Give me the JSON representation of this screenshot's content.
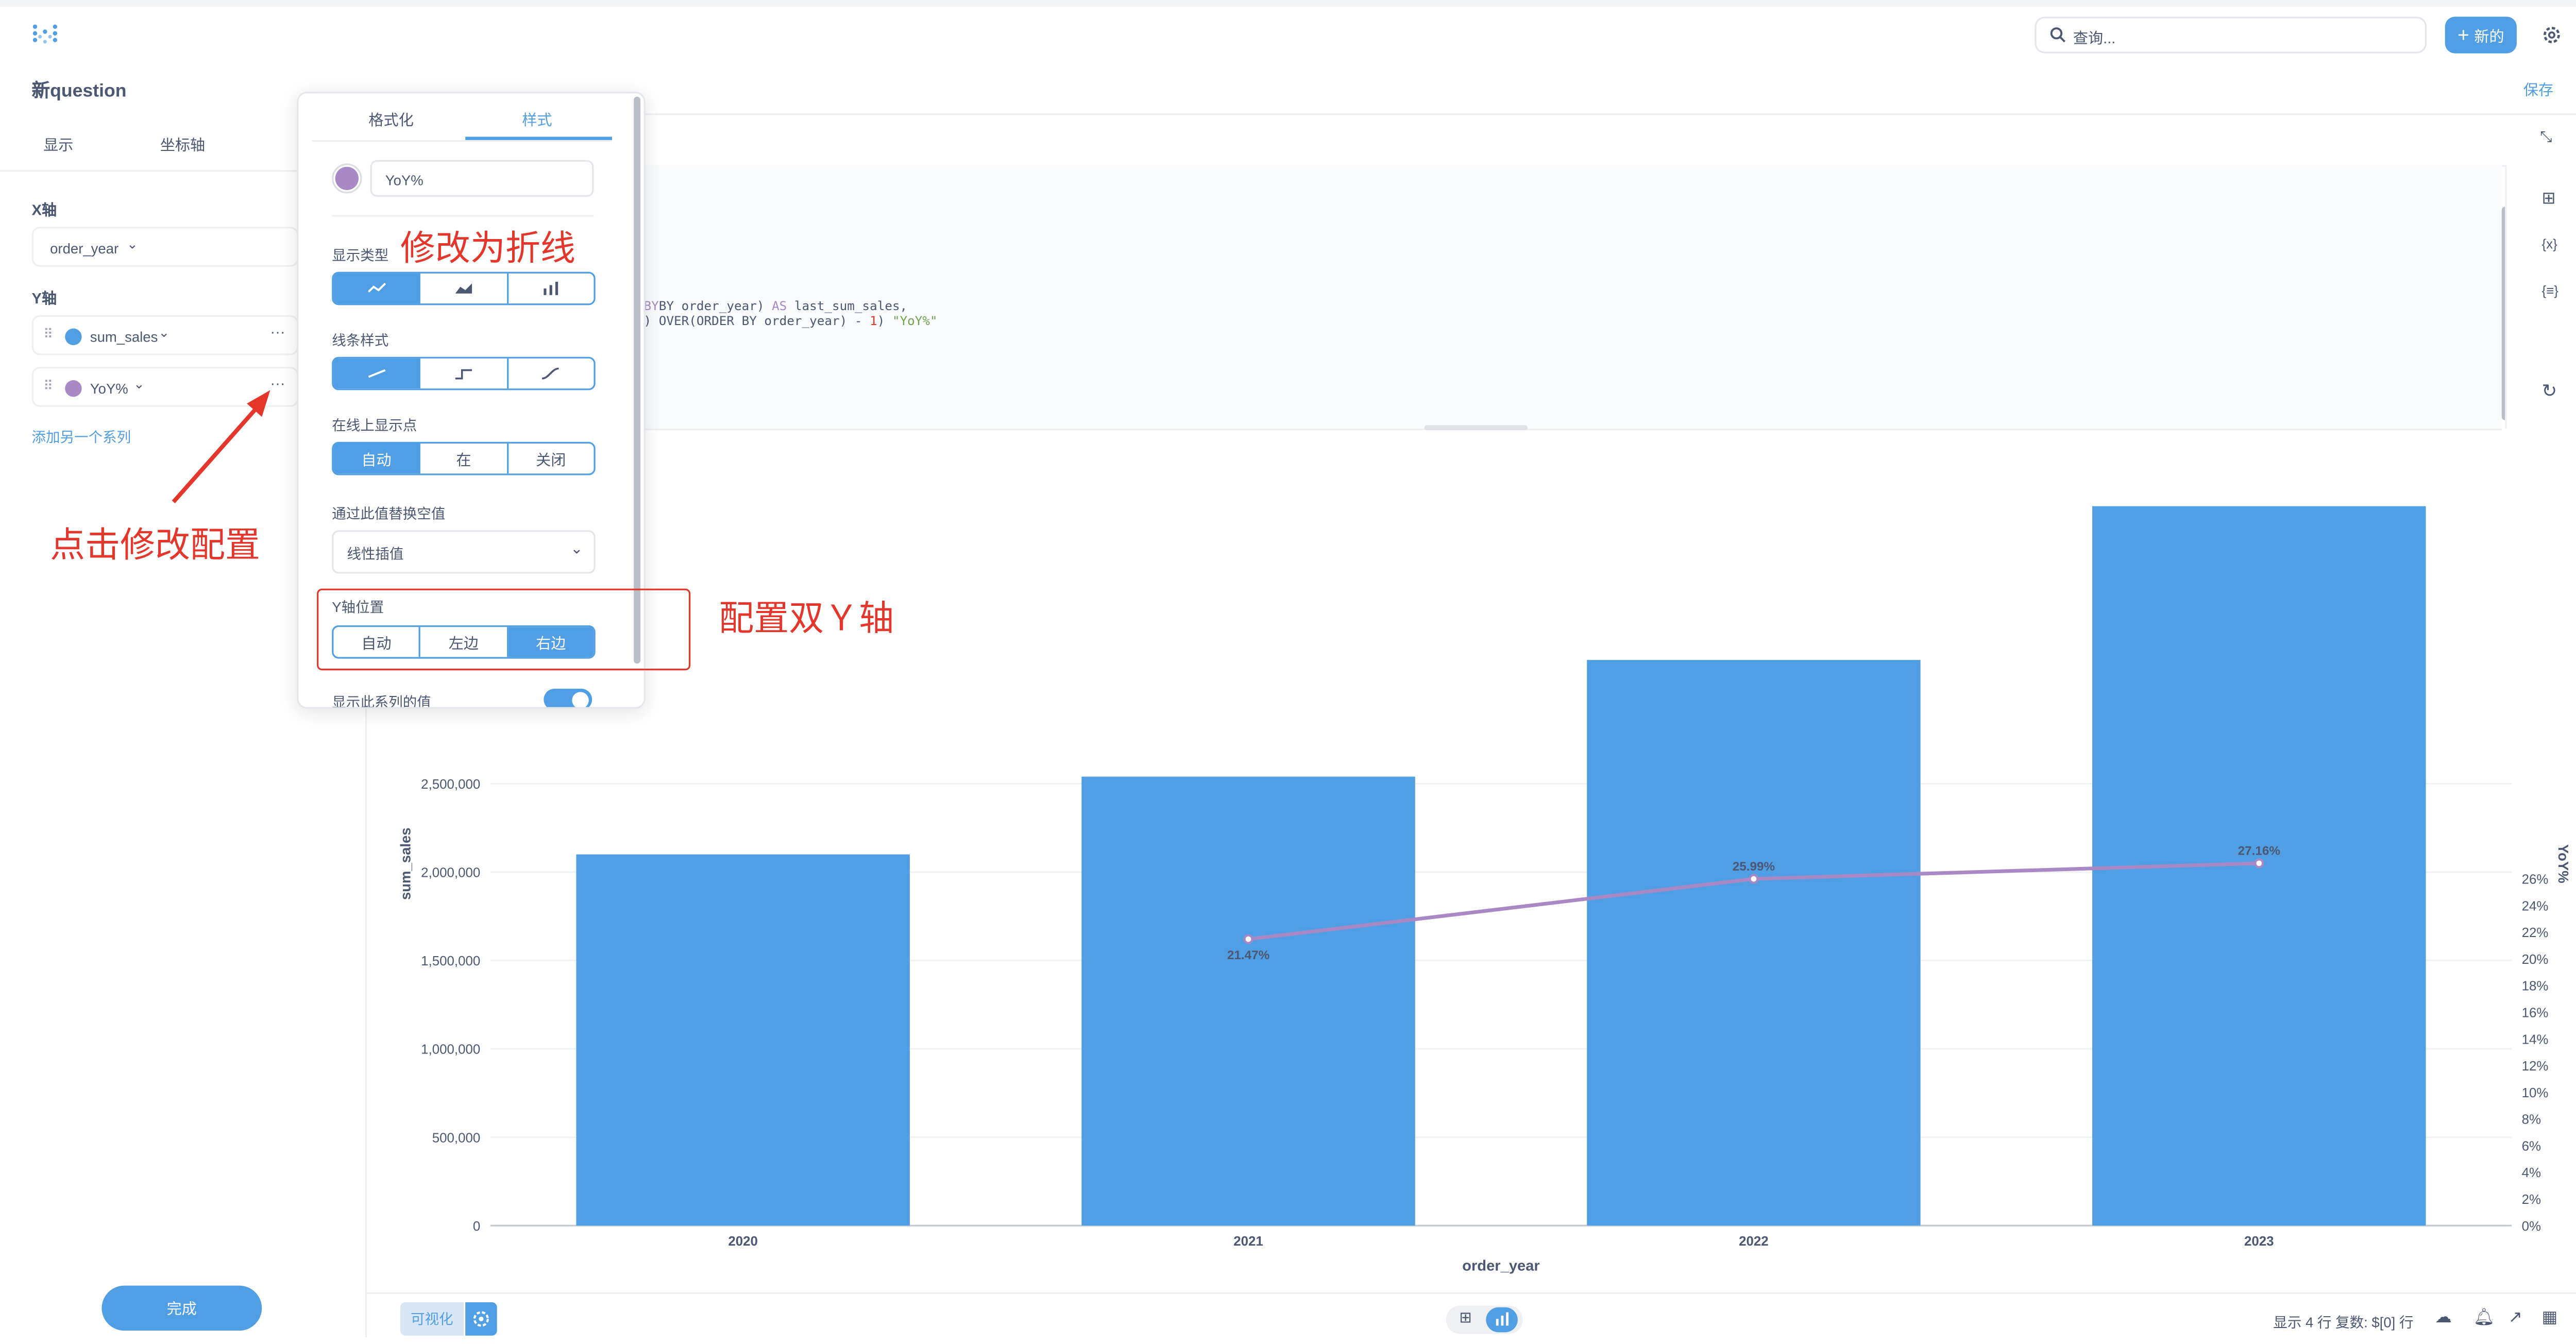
{
  "header": {
    "search_placeholder": "查询...",
    "new_button": "新的",
    "question_title": "新question",
    "save_label": "保存"
  },
  "sidebar": {
    "tabs": [
      "显示",
      "坐标轴"
    ],
    "x_axis_label": "X轴",
    "x_field": "order_year",
    "y_axis_label": "Y轴",
    "y_series": [
      {
        "name": "sum_sales",
        "color": "#509ee3"
      },
      {
        "name": "YoY%",
        "color": "#a989c5"
      }
    ],
    "add_series": "添加另一个系列",
    "done_button": "完成"
  },
  "popover": {
    "tabs": [
      "格式化",
      "样式"
    ],
    "active_tab": "样式",
    "series_name": "YoY%",
    "series_color": "#a989c5",
    "display_type_label": "显示类型",
    "display_type_options": [
      "line",
      "area",
      "bar"
    ],
    "display_type_selected": "line",
    "line_style_label": "线条样式",
    "line_style_options": [
      "linear",
      "step",
      "smooth"
    ],
    "line_style_selected": "linear",
    "show_dots_label": "在线上显示点",
    "show_dots_options": [
      "自动",
      "在",
      "关闭"
    ],
    "show_dots_selected": "自动",
    "replace_missing_label": "通过此值替换空值",
    "replace_missing_value": "线性插值",
    "y_position_label": "Y轴位置",
    "y_position_options": [
      "自动",
      "左边",
      "右边"
    ],
    "y_position_selected": "右边",
    "show_values_label": "显示此系列的值",
    "show_values_on": true
  },
  "annotations": {
    "change_to_line": "修改为折线",
    "click_to_config": "点击修改配置",
    "dual_y_axis": "配置双Ｙ轴"
  },
  "sql_editor": {
    "line1_prefix": "BY order_year) ",
    "line1_kw": "AS",
    "line1_suffix": " last_sum_sales,",
    "line2_prefix": ") OVER(ORDER BY order_year) - ",
    "line2_num": "1",
    "line2_close": ")",
    "line2_alias": "\"YoY%\""
  },
  "chart_data": {
    "type": "bar",
    "categories": [
      "2020",
      "2021",
      "2022",
      "2023"
    ],
    "series": [
      {
        "name": "sum_sales",
        "type": "bar",
        "axis": "left",
        "color": "#509ee3",
        "values": [
          2100000,
          2540000,
          3200000,
          4070000
        ]
      },
      {
        "name": "YoY%",
        "type": "line",
        "axis": "right",
        "color": "#a989c5",
        "values": [
          null,
          21.47,
          25.99,
          27.16
        ],
        "labels": [
          "",
          "21.47%",
          "25.99%",
          "27.16%"
        ]
      }
    ],
    "xlabel": "order_year",
    "ylabel": "sum_sales",
    "y2label": "YoY%",
    "ylim": [
      0,
      5000000
    ],
    "y_ticks": [
      "0",
      "500,000",
      "1,000,000",
      "1,500,000",
      "2,000,000",
      "2,500,000"
    ],
    "y2lim": [
      0,
      28
    ],
    "y2_ticks": [
      "0%",
      "2%",
      "4%",
      "6%",
      "8%",
      "10%",
      "12%",
      "14%",
      "16%",
      "18%",
      "20%",
      "22%",
      "24%",
      "26%"
    ]
  },
  "footer": {
    "visualize_label": "可视化",
    "row_info": "显示 4 行 复数: $[0] 行"
  }
}
